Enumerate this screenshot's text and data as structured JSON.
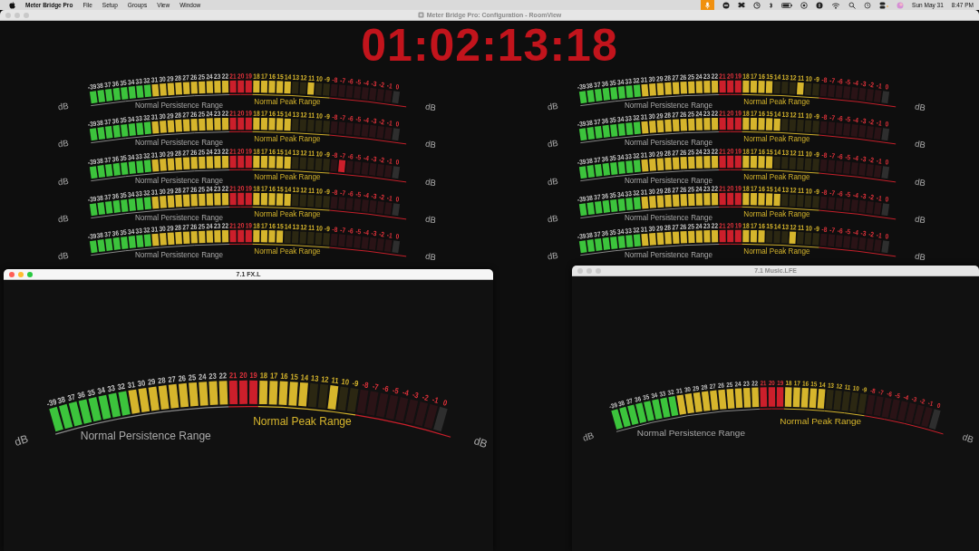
{
  "menu_bar": {
    "app": "Meter Bridge Pro",
    "menus": [
      "File",
      "Setup",
      "Groups",
      "View",
      "Window"
    ],
    "date": "Sun May 31",
    "time": "8:47 PM"
  },
  "main_window": {
    "title": "Meter Bridge Pro: Configuration - RoomView",
    "timecode": "01:02:13:18",
    "meters": [
      {
        "ticks": [
          "-39",
          "38",
          "37",
          "36",
          "35",
          "34",
          "33",
          "32",
          "31",
          "30",
          "29",
          "28",
          "27",
          "26",
          "25",
          "24",
          "23",
          "22",
          "21",
          "20",
          "19",
          "18",
          "17",
          "16",
          "15",
          "14",
          "13",
          "12",
          "11",
          "10",
          "-9",
          "-8",
          "-7",
          "-6",
          "-5",
          "-4",
          "-3",
          "-2",
          "-1",
          "0"
        ],
        "lit": [
          true,
          true,
          true,
          true,
          true,
          true,
          true,
          true,
          true,
          true,
          true,
          true,
          true,
          true,
          true,
          true,
          true,
          true,
          true,
          true,
          true,
          true,
          true,
          true,
          true,
          true,
          false,
          false,
          true,
          false,
          false,
          false,
          false,
          false,
          false,
          false,
          false,
          false,
          false,
          false
        ],
        "persistence_label": "Normal Persistence Range",
        "peak_label": "Normal Peak Range",
        "unit_left": "dB",
        "unit_right": "dB"
      },
      {
        "ticks": [
          "-39",
          "38",
          "37",
          "36",
          "35",
          "34",
          "33",
          "32",
          "31",
          "30",
          "29",
          "28",
          "27",
          "26",
          "25",
          "24",
          "23",
          "22",
          "21",
          "20",
          "19",
          "18",
          "17",
          "16",
          "15",
          "14",
          "13",
          "12",
          "11",
          "10",
          "-9",
          "-8",
          "-7",
          "-6",
          "-5",
          "-4",
          "-3",
          "-2",
          "-1",
          "0"
        ],
        "lit": [
          true,
          true,
          true,
          true,
          true,
          true,
          true,
          true,
          true,
          true,
          true,
          true,
          true,
          true,
          true,
          true,
          true,
          true,
          true,
          true,
          true,
          true,
          true,
          true,
          true,
          true,
          false,
          false,
          false,
          false,
          false,
          false,
          false,
          false,
          false,
          false,
          false,
          false,
          false,
          false
        ],
        "persistence_label": "Normal Persistence Range",
        "peak_label": "Normal Peak Range",
        "unit_left": "dB",
        "unit_right": "dB"
      },
      {
        "ticks": [
          "-39",
          "38",
          "37",
          "36",
          "35",
          "34",
          "33",
          "32",
          "31",
          "30",
          "29",
          "28",
          "27",
          "26",
          "25",
          "24",
          "23",
          "22",
          "21",
          "20",
          "19",
          "18",
          "17",
          "16",
          "15",
          "14",
          "13",
          "12",
          "11",
          "10",
          "-9",
          "-8",
          "-7",
          "-6",
          "-5",
          "-4",
          "-3",
          "-2",
          "-1",
          "0"
        ],
        "lit": [
          true,
          true,
          true,
          true,
          true,
          true,
          true,
          true,
          true,
          true,
          true,
          true,
          true,
          true,
          true,
          true,
          true,
          true,
          true,
          true,
          true,
          true,
          true,
          true,
          true,
          true,
          false,
          false,
          false,
          false,
          false,
          false,
          true,
          false,
          false,
          false,
          false,
          false,
          false,
          false
        ],
        "persistence_label": "Normal Persistence Range",
        "peak_label": "Normal Peak Range",
        "unit_left": "dB",
        "unit_right": "dB"
      },
      {
        "ticks": [
          "-39",
          "38",
          "37",
          "36",
          "35",
          "34",
          "33",
          "32",
          "31",
          "30",
          "29",
          "28",
          "27",
          "26",
          "25",
          "24",
          "23",
          "22",
          "21",
          "20",
          "19",
          "18",
          "17",
          "16",
          "15",
          "14",
          "13",
          "12",
          "11",
          "10",
          "-9",
          "-8",
          "-7",
          "-6",
          "-5",
          "-4",
          "-3",
          "-2",
          "-1",
          "0"
        ],
        "lit": [
          true,
          true,
          true,
          true,
          true,
          true,
          true,
          true,
          true,
          true,
          true,
          true,
          true,
          true,
          true,
          true,
          true,
          true,
          true,
          true,
          true,
          true,
          true,
          true,
          true,
          true,
          false,
          false,
          false,
          false,
          false,
          false,
          false,
          false,
          false,
          false,
          false,
          false,
          false,
          false
        ],
        "persistence_label": "Normal Persistence Range",
        "peak_label": "Normal Peak Range",
        "unit_left": "dB",
        "unit_right": "dB"
      },
      {
        "ticks": [
          "-39",
          "38",
          "37",
          "36",
          "35",
          "34",
          "33",
          "32",
          "31",
          "30",
          "29",
          "28",
          "27",
          "26",
          "25",
          "24",
          "23",
          "22",
          "21",
          "20",
          "19",
          "18",
          "17",
          "16",
          "15",
          "14",
          "13",
          "12",
          "11",
          "10",
          "-9",
          "-8",
          "-7",
          "-6",
          "-5",
          "-4",
          "-3",
          "-2",
          "-1",
          "0"
        ],
        "lit": [
          true,
          true,
          true,
          true,
          true,
          true,
          true,
          true,
          true,
          true,
          true,
          true,
          true,
          true,
          true,
          true,
          true,
          true,
          true,
          true,
          true,
          true,
          true,
          true,
          true,
          false,
          false,
          false,
          false,
          false,
          false,
          false,
          false,
          false,
          false,
          false,
          false,
          false,
          false,
          false
        ],
        "persistence_label": "Normal Persistence Range",
        "peak_label": "Normal Peak Range",
        "unit_left": "dB",
        "unit_right": "dB"
      },
      {
        "ticks": [
          "-39",
          "38",
          "37",
          "36",
          "35",
          "34",
          "33",
          "32",
          "31",
          "30",
          "29",
          "28",
          "27",
          "26",
          "25",
          "24",
          "23",
          "22",
          "21",
          "20",
          "19",
          "18",
          "17",
          "16",
          "15",
          "14",
          "13",
          "12",
          "11",
          "10",
          "-9",
          "-8",
          "-7",
          "-6",
          "-5",
          "-4",
          "-3",
          "-2",
          "-1",
          "0"
        ],
        "lit": [
          true,
          true,
          true,
          true,
          true,
          true,
          true,
          true,
          true,
          true,
          true,
          true,
          true,
          true,
          true,
          true,
          true,
          true,
          true,
          true,
          true,
          true,
          true,
          true,
          true,
          false,
          false,
          false,
          true,
          false,
          false,
          false,
          false,
          false,
          false,
          false,
          false,
          false,
          false,
          false
        ],
        "persistence_label": "Normal Persistence Range",
        "peak_label": "Normal Peak Range",
        "unit_left": "dB",
        "unit_right": "dB"
      },
      {
        "ticks": [
          "-39",
          "38",
          "37",
          "36",
          "35",
          "34",
          "33",
          "32",
          "31",
          "30",
          "29",
          "28",
          "27",
          "26",
          "25",
          "24",
          "23",
          "22",
          "21",
          "20",
          "19",
          "18",
          "17",
          "16",
          "15",
          "14",
          "13",
          "12",
          "11",
          "10",
          "-9",
          "-8",
          "-7",
          "-6",
          "-5",
          "-4",
          "-3",
          "-2",
          "-1",
          "0"
        ],
        "lit": [
          true,
          true,
          true,
          true,
          true,
          true,
          true,
          true,
          true,
          true,
          true,
          true,
          true,
          true,
          true,
          true,
          true,
          true,
          true,
          true,
          true,
          true,
          true,
          true,
          true,
          true,
          false,
          false,
          false,
          false,
          false,
          false,
          false,
          false,
          false,
          false,
          false,
          false,
          false,
          false
        ],
        "persistence_label": "Normal Persistence Range",
        "peak_label": "Normal Peak Range",
        "unit_left": "dB",
        "unit_right": "dB"
      },
      {
        "ticks": [
          "-39",
          "38",
          "37",
          "36",
          "35",
          "34",
          "33",
          "32",
          "31",
          "30",
          "29",
          "28",
          "27",
          "26",
          "25",
          "24",
          "23",
          "22",
          "21",
          "20",
          "19",
          "18",
          "17",
          "16",
          "15",
          "14",
          "13",
          "12",
          "11",
          "10",
          "-9",
          "-8",
          "-7",
          "-6",
          "-5",
          "-4",
          "-3",
          "-2",
          "-1",
          "0"
        ],
        "lit": [
          true,
          true,
          true,
          true,
          true,
          true,
          true,
          true,
          true,
          true,
          true,
          true,
          true,
          true,
          true,
          true,
          true,
          true,
          true,
          true,
          true,
          true,
          true,
          true,
          true,
          false,
          false,
          false,
          false,
          false,
          false,
          false,
          false,
          false,
          false,
          false,
          false,
          false,
          false,
          false
        ],
        "persistence_label": "Normal Persistence Range",
        "peak_label": "Normal Peak Range",
        "unit_left": "dB",
        "unit_right": "dB"
      },
      {
        "ticks": [
          "-39",
          "38",
          "37",
          "36",
          "35",
          "34",
          "33",
          "32",
          "31",
          "30",
          "29",
          "28",
          "27",
          "26",
          "25",
          "24",
          "23",
          "22",
          "21",
          "20",
          "19",
          "18",
          "17",
          "16",
          "15",
          "14",
          "13",
          "12",
          "11",
          "10",
          "-9",
          "-8",
          "-7",
          "-6",
          "-5",
          "-4",
          "-3",
          "-2",
          "-1",
          "0"
        ],
        "lit": [
          true,
          true,
          true,
          true,
          true,
          true,
          true,
          true,
          true,
          true,
          true,
          true,
          true,
          true,
          true,
          true,
          true,
          true,
          true,
          true,
          true,
          true,
          true,
          true,
          true,
          true,
          false,
          false,
          false,
          false,
          false,
          false,
          false,
          false,
          false,
          false,
          false,
          false,
          false,
          false
        ],
        "persistence_label": "Normal Persistence Range",
        "peak_label": "Normal Peak Range",
        "unit_left": "dB",
        "unit_right": "dB"
      },
      {
        "ticks": [
          "-39",
          "38",
          "37",
          "36",
          "35",
          "34",
          "33",
          "32",
          "31",
          "30",
          "29",
          "28",
          "27",
          "26",
          "25",
          "24",
          "23",
          "22",
          "21",
          "20",
          "19",
          "18",
          "17",
          "16",
          "15",
          "14",
          "13",
          "12",
          "11",
          "10",
          "-9",
          "-8",
          "-7",
          "-6",
          "-5",
          "-4",
          "-3",
          "-2",
          "-1",
          "0"
        ],
        "lit": [
          true,
          true,
          true,
          true,
          true,
          true,
          true,
          true,
          true,
          true,
          true,
          true,
          true,
          true,
          true,
          true,
          true,
          true,
          true,
          true,
          true,
          true,
          true,
          true,
          false,
          false,
          false,
          true,
          false,
          false,
          false,
          false,
          false,
          false,
          false,
          false,
          false,
          false,
          false,
          false
        ],
        "persistence_label": "Normal Persistence Range",
        "peak_label": "Normal Peak Range",
        "unit_left": "dB",
        "unit_right": "dB"
      }
    ]
  },
  "windows": [
    {
      "title": "7.1 FX.L",
      "active": true,
      "meter": {
        "ticks": [
          "-39",
          "38",
          "37",
          "36",
          "35",
          "34",
          "33",
          "32",
          "31",
          "30",
          "29",
          "28",
          "27",
          "26",
          "25",
          "24",
          "23",
          "22",
          "21",
          "20",
          "19",
          "18",
          "17",
          "16",
          "15",
          "14",
          "13",
          "12",
          "11",
          "10",
          "-9",
          "-8",
          "-7",
          "-6",
          "-5",
          "-4",
          "-3",
          "-2",
          "-1",
          "0"
        ],
        "lit": [
          true,
          true,
          true,
          true,
          true,
          true,
          true,
          true,
          true,
          true,
          true,
          true,
          true,
          true,
          true,
          true,
          true,
          true,
          true,
          true,
          true,
          true,
          true,
          true,
          true,
          true,
          false,
          false,
          true,
          false,
          false,
          false,
          false,
          false,
          false,
          false,
          false,
          false,
          false,
          false
        ],
        "persistence_label": "Normal Persistence Range",
        "peak_label": "Normal Peak Range",
        "unit_left": "dB",
        "unit_right": "dB"
      }
    },
    {
      "title": "7.1 Music.LFE",
      "active": false,
      "meter": {
        "ticks": [
          "-39",
          "38",
          "37",
          "36",
          "35",
          "34",
          "33",
          "32",
          "31",
          "30",
          "29",
          "28",
          "27",
          "26",
          "25",
          "24",
          "23",
          "22",
          "21",
          "20",
          "19",
          "18",
          "17",
          "16",
          "15",
          "14",
          "13",
          "12",
          "11",
          "10",
          "-9",
          "-8",
          "-7",
          "-6",
          "-5",
          "-4",
          "-3",
          "-2",
          "-1",
          "0"
        ],
        "lit": [
          true,
          true,
          true,
          true,
          true,
          true,
          true,
          true,
          true,
          true,
          true,
          true,
          true,
          true,
          true,
          true,
          true,
          true,
          true,
          true,
          true,
          true,
          true,
          true,
          true,
          true,
          false,
          false,
          false,
          false,
          false,
          false,
          false,
          false,
          false,
          false,
          false,
          false,
          false,
          false
        ],
        "persistence_label": "Normal Persistence Range",
        "peak_label": "Normal Peak Range",
        "unit_left": "dB",
        "unit_right": "dB"
      }
    }
  ]
}
